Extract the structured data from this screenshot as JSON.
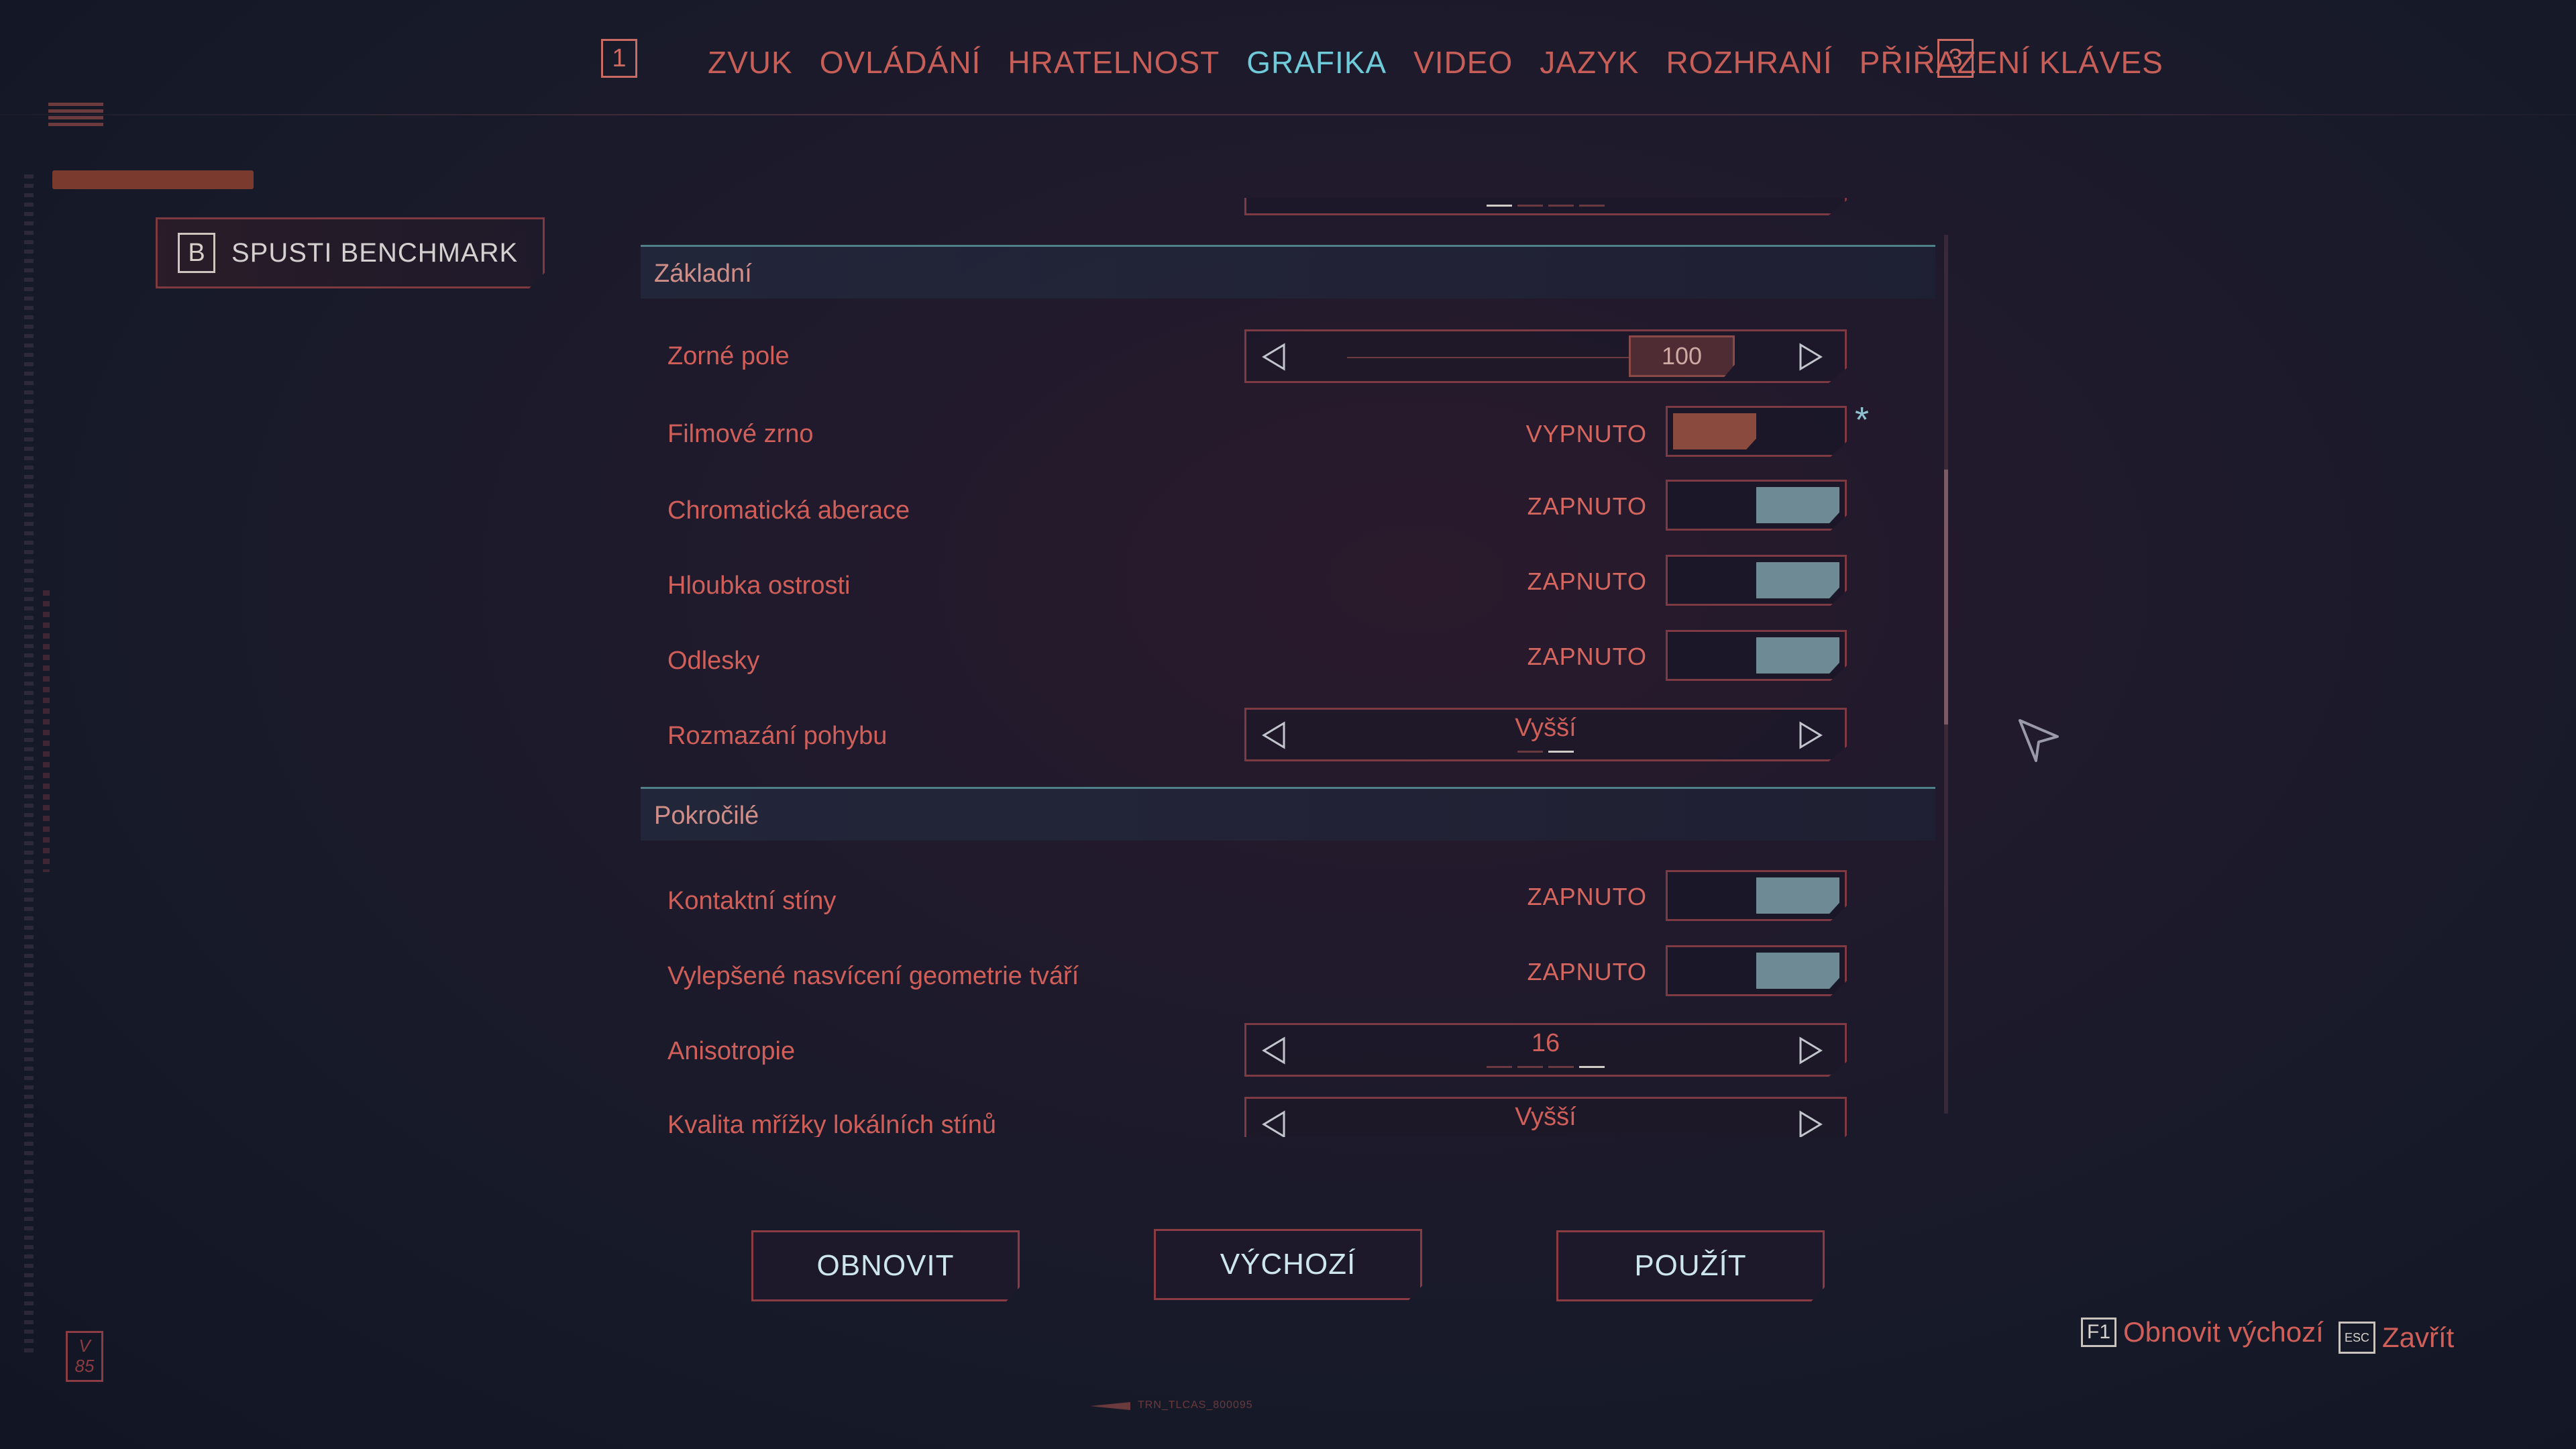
{
  "top_nav": {
    "prev_key": "1",
    "next_key": "3",
    "tabs": [
      {
        "label": "ZVUK"
      },
      {
        "label": "OVLÁDÁNÍ"
      },
      {
        "label": "HRATELNOST"
      },
      {
        "label": "GRAFIKA",
        "active": true
      },
      {
        "label": "VIDEO"
      },
      {
        "label": "JAZYK"
      },
      {
        "label": "ROZHRANÍ"
      },
      {
        "label": "PŘIŘAZENÍ KLÁVES"
      }
    ]
  },
  "benchmark": {
    "key": "B",
    "label": "SPUSTI BENCHMARK"
  },
  "sections": {
    "basic": {
      "title": "Základní",
      "fov": {
        "label": "Zorné pole",
        "value": "100"
      },
      "film_grain": {
        "label": "Filmové zrno",
        "state": "VYPNUTO",
        "on": false,
        "modified_marker": "*"
      },
      "chromatic": {
        "label": "Chromatická aberace",
        "state": "ZAPNUTO",
        "on": true
      },
      "dof": {
        "label": "Hloubka ostrosti",
        "state": "ZAPNUTO",
        "on": true
      },
      "lens_flare": {
        "label": "Odlesky",
        "state": "ZAPNUTO",
        "on": true
      },
      "motion_blur": {
        "label": "Rozmazání pohybu",
        "value": "Vyšší"
      }
    },
    "advanced": {
      "title": "Pokročilé",
      "contact_shadows": {
        "label": "Kontaktní stíny",
        "state": "ZAPNUTO",
        "on": true
      },
      "face_lighting": {
        "label": "Vylepšené nasvícení geometrie tváří",
        "state": "ZAPNUTO",
        "on": true
      },
      "anisotropy": {
        "label": "Anisotropie",
        "value": "16"
      },
      "local_shadow_mesh": {
        "label": "Kvalita mřížky lokálních stínů",
        "value": "Vyšší"
      }
    }
  },
  "buttons": {
    "refresh": "OBNOVIT",
    "defaults": "VÝCHOZÍ",
    "apply": "POUŽÍT"
  },
  "hints": {
    "restore_key": "F1",
    "restore_label": "Obnovit výchozí",
    "close_key": "ESC",
    "close_label": "Zavřít"
  },
  "version_badge": "V 85",
  "build_tag": "TRN_TLCAS_800095",
  "colors": {
    "accent_active": "#6fcad9",
    "text_red": "#cf5f58",
    "toggle_on": "#6e8a94",
    "toggle_off": "#8a4a3e"
  }
}
